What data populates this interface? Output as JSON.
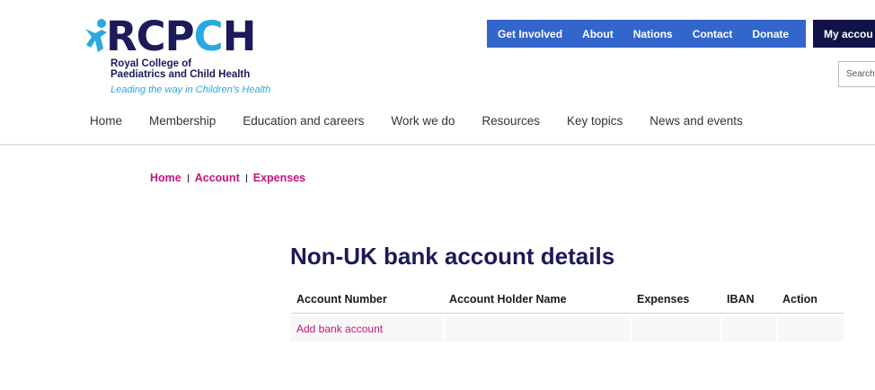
{
  "logo": {
    "wordmark_part1": "RCP",
    "wordmark_part2": "C",
    "wordmark_part3": "H",
    "line1": "Royal College of",
    "line2": "Paediatrics and Child Health",
    "tagline": "Leading the way in Children's Health",
    "colors": {
      "navy": "#1b1a5a",
      "cyan": "#2aa9e0"
    }
  },
  "top_nav": {
    "items": [
      "Get Involved",
      "About",
      "Nations",
      "Contact",
      "Donate"
    ],
    "my_account": "My accou",
    "color": "#3366cc",
    "my_account_color": "#12124a"
  },
  "search": {
    "placeholder": "Search"
  },
  "main_nav": {
    "items": [
      "Home",
      "Membership",
      "Education and careers",
      "Work we do",
      "Resources",
      "Key topics",
      "News and events"
    ]
  },
  "breadcrumb": {
    "items": [
      "Home",
      "Account",
      "Expenses"
    ],
    "color": "#c4147a"
  },
  "page": {
    "title": "Non-UK bank account details"
  },
  "table": {
    "headers": [
      "Account Number",
      "Account Holder Name",
      "Expenses",
      "IBAN",
      "Action"
    ],
    "add_link": "Add bank account"
  }
}
